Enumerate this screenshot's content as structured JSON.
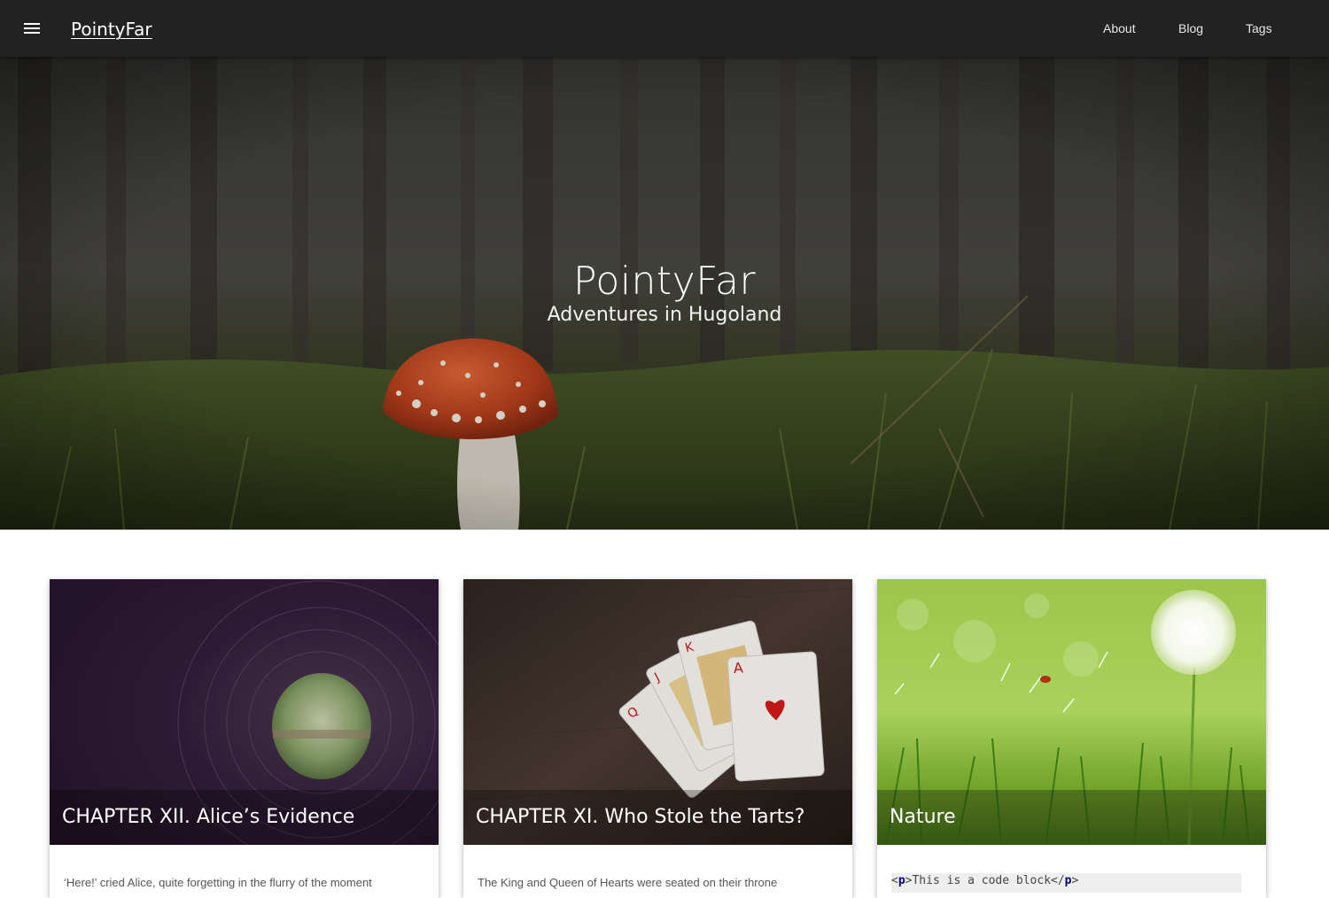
{
  "navbar": {
    "brand": "PointyFar",
    "links": [
      {
        "label": "About"
      },
      {
        "label": "Blog"
      },
      {
        "label": "Tags"
      }
    ],
    "background": "#222222"
  },
  "hero": {
    "title": "PointyFar",
    "subtitle": "Adventures in Hugoland"
  },
  "cards": [
    {
      "title": "CHAPTER XII. Alice’s Evidence",
      "excerpt": "‘Here!’ cried Alice, quite forgetting in the flurry of the moment"
    },
    {
      "title": "CHAPTER XI. Who Stole the Tarts?",
      "excerpt": "The King and Queen of Hearts were seated on their throne"
    },
    {
      "title": "Nature",
      "code": {
        "open_lt": "<",
        "open_tag": "p",
        "text": ">This is a code block</",
        "close_tag": "p",
        "close_gt": ">"
      }
    }
  ]
}
